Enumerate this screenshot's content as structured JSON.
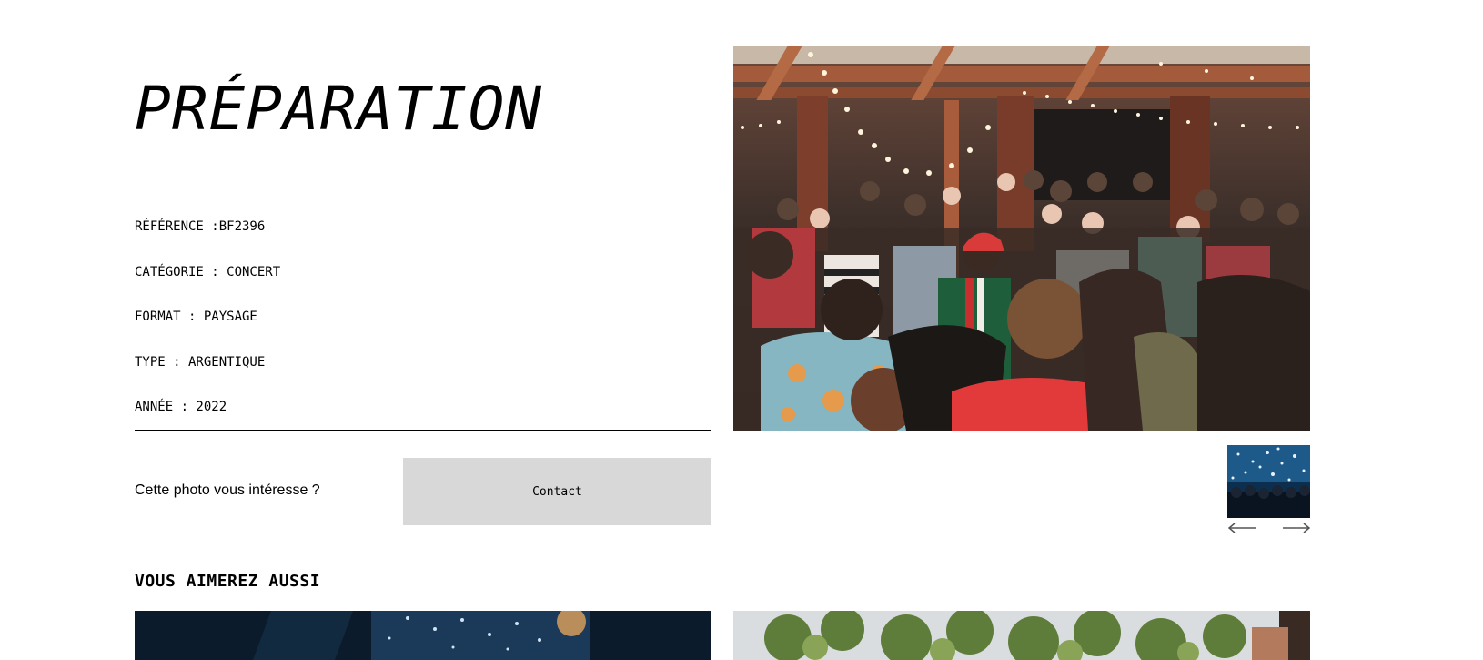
{
  "photo": {
    "title": "PRÉPARATION",
    "details": [
      "RÉFÉRENCE :BF2396",
      "CATÉGORIE : CONCERT",
      "FORMAT : PAYSAGE",
      "TYPE : ARGENTIQUE",
      "ANNÉE : 2022"
    ]
  },
  "contact_section": {
    "prompt": "Cette photo vous intéresse ?",
    "button_label": "Contact"
  },
  "navigation": {
    "prev_icon": "arrow-left-icon",
    "next_icon": "arrow-right-icon"
  },
  "related": {
    "heading": "VOUS AIMEREZ AUSSI"
  }
}
